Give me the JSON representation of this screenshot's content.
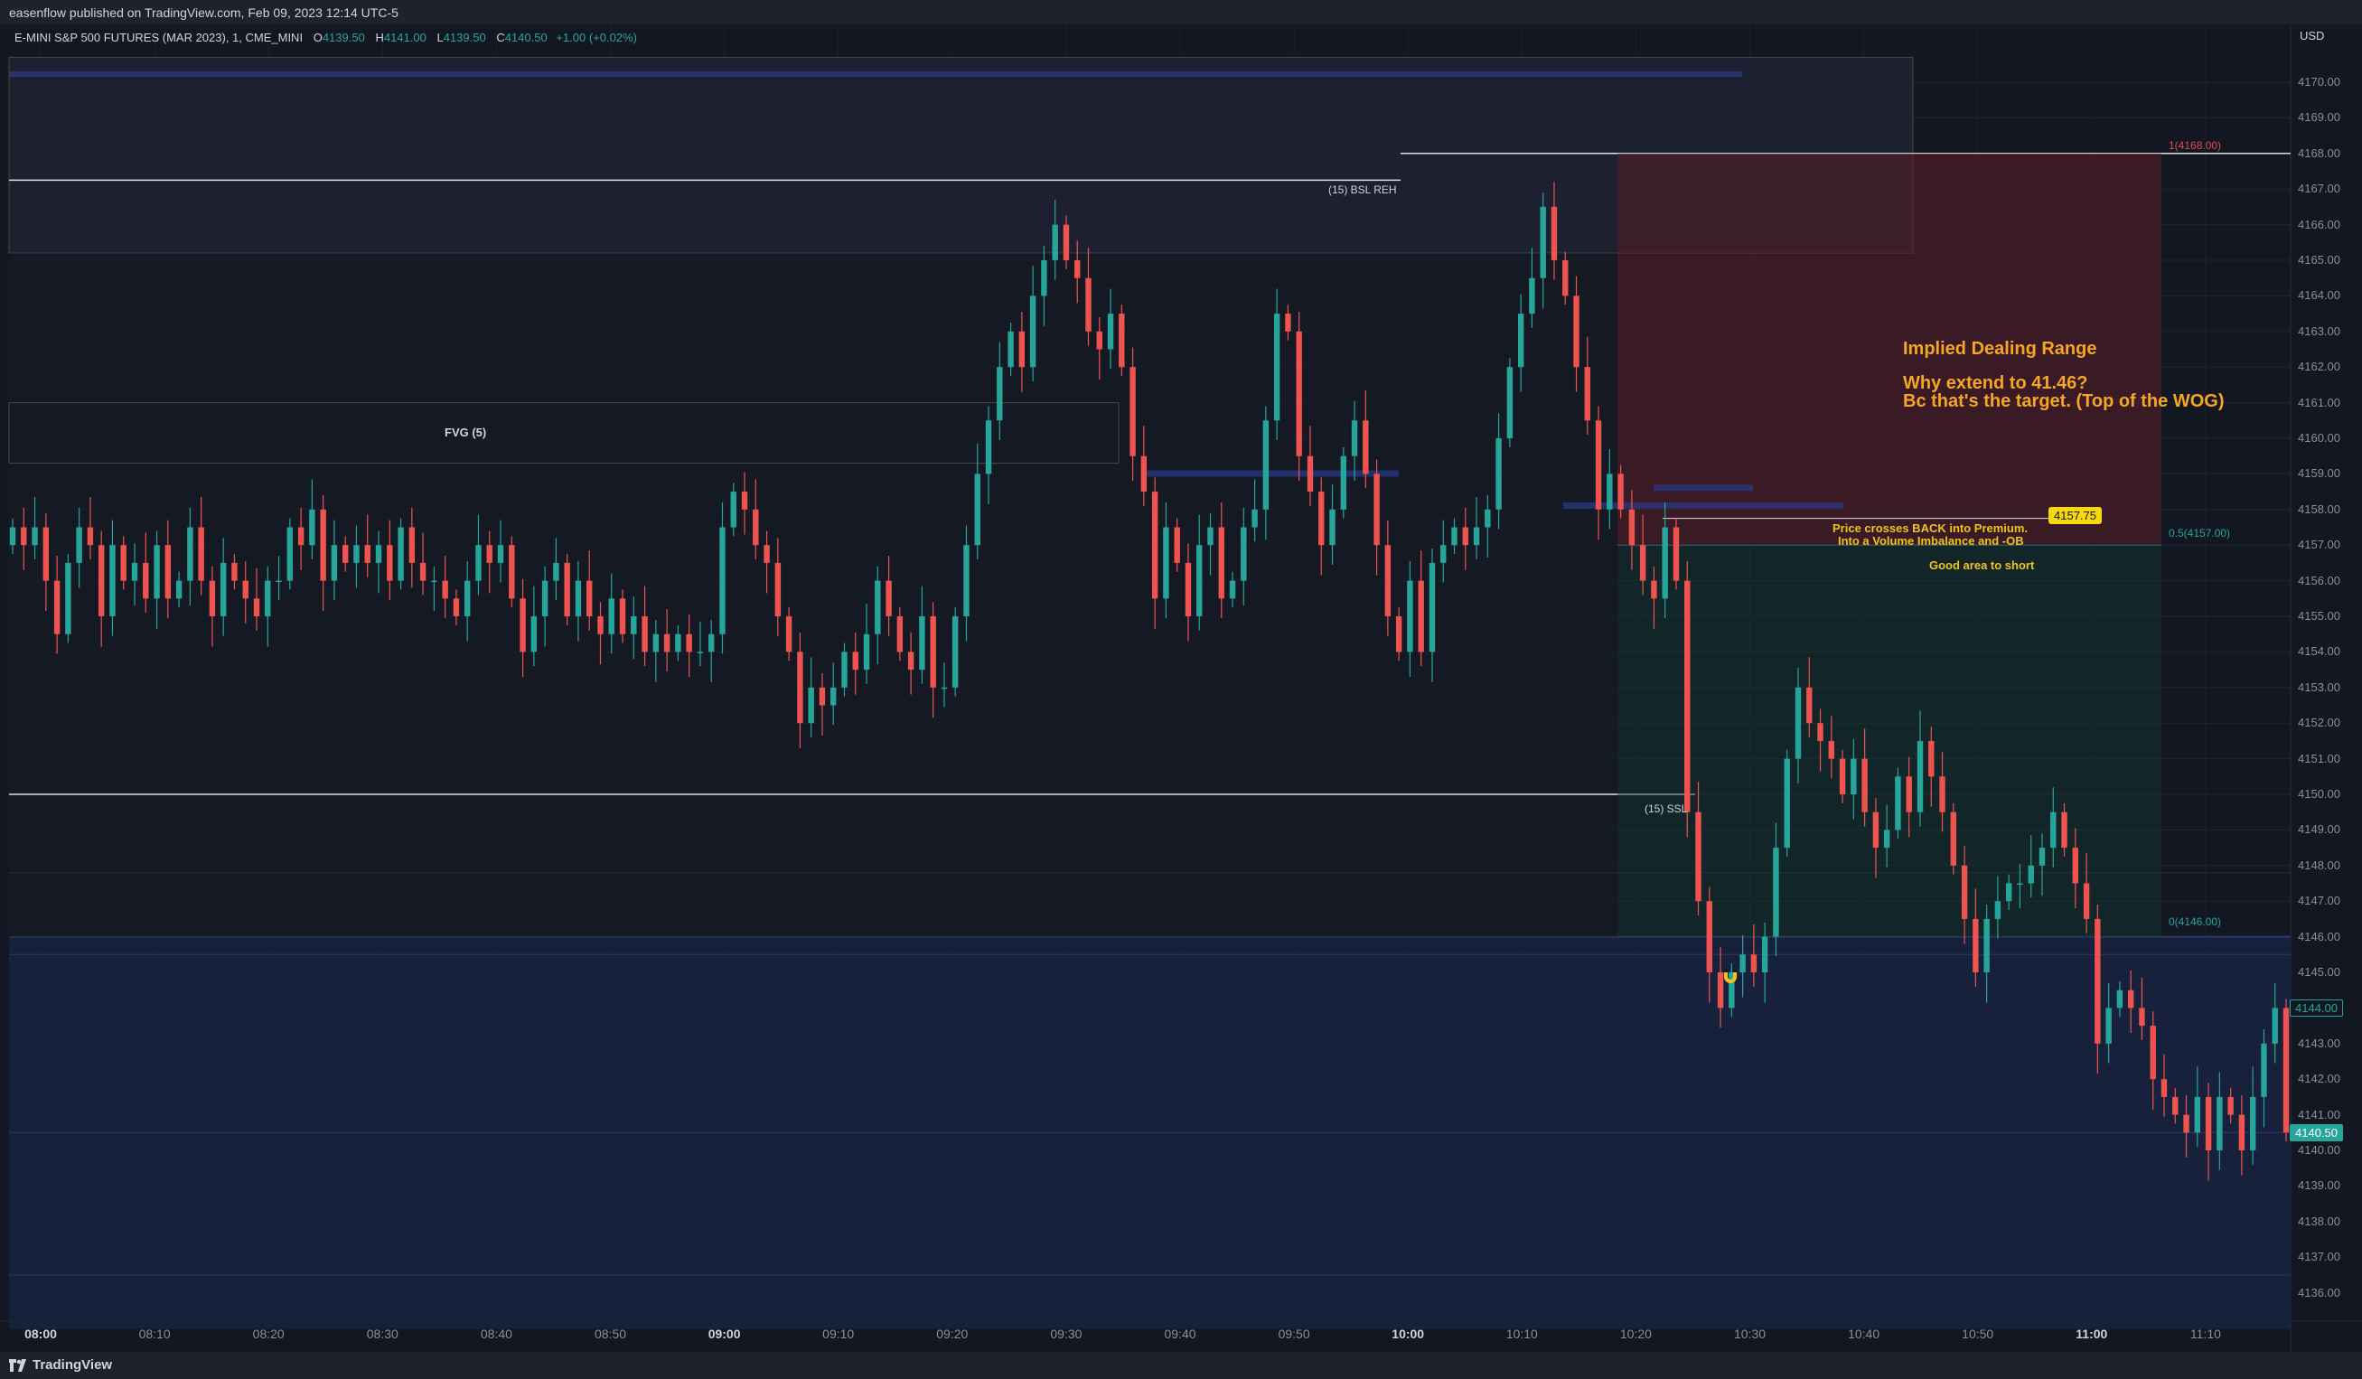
{
  "header": {
    "published": "easenflow published on TradingView.com, Feb 09, 2023 12:14 UTC-5"
  },
  "legend": {
    "symbol": "E-MINI S&P 500 FUTURES (MAR 2023), 1, CME_MINI",
    "o_label": "O",
    "o_value": "4139.50",
    "h_label": "H",
    "h_value": "4141.00",
    "l_label": "L",
    "l_value": "4139.50",
    "c_label": "C",
    "c_value": "4140.50",
    "change": "+1.00 (+0.02%)"
  },
  "footer": {
    "brand": "TradingView"
  },
  "colors": {
    "background": "#131722",
    "up": "#26a69a",
    "down": "#ef5350",
    "accent_orange": "#f5a623",
    "accent_yellow": "#f0c419",
    "zone_blue": "#1a2340"
  },
  "annotations": {
    "fvg": "FVG (5)",
    "bsl": "(15) BSL REH",
    "ssl": "(15) SSL",
    "fib_1": "1(4168.00)",
    "fib_05": "0.5(4157.00)",
    "fib_0": "0(4146.00)",
    "implied_range": "Implied Dealing Range",
    "question": "Why extend to 41.46?",
    "answer": "Bc that's the target. (Top of the WOG)",
    "cross_line1": "Price crosses BACK into Premium.",
    "cross_line2": "Into a Volume Imbalance and -OB",
    "good_short": "Good area to short",
    "price_tag": "4157.75"
  },
  "chart_data": {
    "type": "candlestick",
    "currency": "USD",
    "y_ticks": [
      "4170.00",
      "4169.00",
      "4168.00",
      "4167.00",
      "4166.00",
      "4165.00",
      "4164.00",
      "4163.00",
      "4162.00",
      "4161.00",
      "4160.00",
      "4159.00",
      "4158.00",
      "4157.00",
      "4156.00",
      "4155.00",
      "4154.00",
      "4153.00",
      "4152.00",
      "4151.00",
      "4150.00",
      "4149.00",
      "4148.00",
      "4147.00",
      "4146.00",
      "4145.00",
      "4144.00",
      "4143.00",
      "4142.00",
      "4141.00",
      "4140.00",
      "4139.00",
      "4138.00",
      "4137.00",
      "4136.00"
    ],
    "ylim": [
      4135.5,
      4171.5
    ],
    "x_ticks": [
      "08:00",
      "08:10",
      "08:20",
      "08:30",
      "08:40",
      "08:50",
      "09:00",
      "09:10",
      "09:20",
      "09:30",
      "09:40",
      "09:50",
      "10:00",
      "10:10",
      "10:20",
      "10:30",
      "10:40",
      "10:50",
      "11:00",
      "11:10"
    ],
    "x_ticks_bold": [
      "08:00",
      "09:00",
      "10:00",
      "11:00"
    ],
    "current_prices": [
      {
        "value": "4144.00",
        "color": "#131722",
        "border": "#26a69a",
        "text": "#26a69a"
      },
      {
        "value": "4140.50",
        "color": "#26a69a",
        "border": "#26a69a",
        "text": "#ffffff"
      }
    ],
    "levels": {
      "bsl": 4167.25,
      "ssl": 4150.0,
      "fib_1": 4168.0,
      "fib_05": 4157.0,
      "fib_0": 4146.0,
      "wog_top": 4146.0,
      "wog_bottom": 4136.0
    },
    "candle_closes": [
      4157.5,
      4157,
      4157.5,
      4156,
      4154.5,
      4156.5,
      4157.5,
      4157,
      4155,
      4157,
      4156,
      4156.5,
      4155.5,
      4157,
      4155.5,
      4156,
      4157.5,
      4156,
      4155,
      4156.5,
      4156,
      4155.5,
      4155,
      4156,
      4156,
      4157.5,
      4157,
      4158,
      4156,
      4157,
      4156.5,
      4157,
      4156.5,
      4157,
      4156,
      4157.5,
      4156.5,
      4156,
      4156,
      4155.5,
      4155,
      4156,
      4157,
      4156.5,
      4157,
      4155.5,
      4154,
      4155,
      4156,
      4156.5,
      4155,
      4156,
      4155,
      4154.5,
      4155.5,
      4154.5,
      4155,
      4154,
      4154.5,
      4154,
      4154.5,
      4154,
      4154,
      4154.5,
      4157.5,
      4158.5,
      4158,
      4157,
      4156.5,
      4155,
      4154,
      4152,
      4153,
      4152.5,
      4153,
      4154,
      4153.5,
      4154.5,
      4156,
      4155,
      4154,
      4153.5,
      4155,
      4153,
      4153,
      4155,
      4157,
      4159,
      4160.5,
      4162,
      4163,
      4162,
      4164,
      4165,
      4166,
      4165,
      4164.5,
      4163,
      4162.5,
      4163.5,
      4162,
      4159.5,
      4158.5,
      4155.5,
      4157.5,
      4156.5,
      4155,
      4157,
      4157.5,
      4155.5,
      4156,
      4157.5,
      4158,
      4160.5,
      4163.5,
      4163,
      4159.5,
      4158.5,
      4157,
      4158,
      4159.5,
      4160.5,
      4159,
      4157,
      4155,
      4154,
      4156,
      4154,
      4156.5,
      4157,
      4157.5,
      4157,
      4157.5,
      4158,
      4160,
      4162,
      4163.5,
      4164.5,
      4166.5,
      4165,
      4164,
      4162,
      4160.5,
      4158,
      4159,
      4158,
      4157,
      4156,
      4155.5,
      4157.5,
      4156,
      4149.5,
      4147,
      4145,
      4144,
      4145,
      4145.5,
      4145,
      4146,
      4148.5,
      4151,
      4153,
      4152,
      4151.5,
      4151,
      4150,
      4151,
      4149.5,
      4148.5,
      4149,
      4150.5,
      4149.5,
      4151.5,
      4150.5,
      4149.5,
      4148,
      4146.5,
      4145,
      4146.5,
      4147,
      4147.5,
      4147.5,
      4148,
      4148.5,
      4149.5,
      4148.5,
      4147.5,
      4146.5,
      4143,
      4144,
      4144.5,
      4144,
      4143.5,
      4142,
      4141.5,
      4141,
      4140.5,
      4141.5,
      4140,
      4141.5,
      4141,
      4140,
      4141.5,
      4143,
      4144,
      4140.5
    ]
  }
}
